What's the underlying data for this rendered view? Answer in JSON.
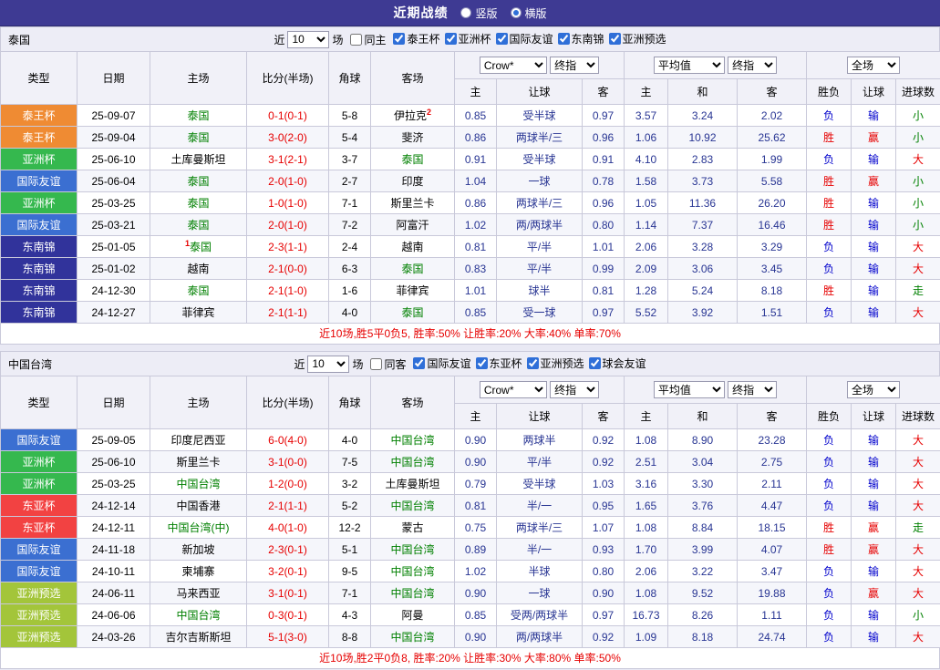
{
  "topbar": {
    "title": "近期战绩",
    "radio_vertical": "竖版",
    "radio_horizontal": "横版"
  },
  "labels": {
    "recent_pre": "近",
    "recent_post": "场"
  },
  "header": {
    "type": "类型",
    "date": "日期",
    "home": "主场",
    "score": "比分(半场)",
    "corner": "角球",
    "away": "客场",
    "sub_home": "主",
    "sub_handicap": "让球",
    "sub_away": "客",
    "avg_home": "主",
    "avg_draw": "和",
    "avg_away": "客",
    "result": "胜负",
    "result_handicap": "让球",
    "result_goals": "进球数"
  },
  "selects": {
    "company": "Crow*",
    "final": "终指",
    "average": "平均值",
    "scope": "全场"
  },
  "type_colors": {
    "泰王杯": "#ef8b33",
    "亚洲杯": "#35b84e",
    "国际友谊": "#3b6fd1",
    "东南锦": "#31339b",
    "东亚杯": "#f24242",
    "亚洲预选": "#a3c53a"
  },
  "outcome_colors": {
    "win": "#e60000",
    "lose": "#0000cc",
    "push": "#008000"
  },
  "outcome_map": {
    "胜": "win",
    "赢": "win",
    "大": "win",
    "负": "lose",
    "输": "lose",
    "小": "push",
    "走": "push"
  },
  "sections": [
    {
      "team": "泰国",
      "filter": {
        "recent": "10",
        "same_label": "同主",
        "same_checked": false,
        "comps": [
          {
            "label": "泰王杯",
            "checked": true
          },
          {
            "label": "亚洲杯",
            "checked": true
          },
          {
            "label": "国际友谊",
            "checked": true
          },
          {
            "label": "东南锦",
            "checked": true
          },
          {
            "label": "亚洲预选",
            "checked": true
          }
        ]
      },
      "rows": [
        {
          "type": "泰王杯",
          "date": "25-09-07",
          "home": "泰国",
          "home_hl": true,
          "score": "0-1(0-1)",
          "corner": "5-8",
          "away": "伊拉克",
          "away_sup": "2",
          "o1": "0.85",
          "hc": "受半球",
          "o2": "0.97",
          "a1": "3.57",
          "a2": "3.24",
          "a3": "2.02",
          "res": "负",
          "hres": "输",
          "goal": "小"
        },
        {
          "type": "泰王杯",
          "date": "25-09-04",
          "home": "泰国",
          "home_hl": true,
          "score": "3-0(2-0)",
          "corner": "5-4",
          "away": "斐济",
          "o1": "0.86",
          "hc": "两球半/三",
          "o2": "0.96",
          "a1": "1.06",
          "a2": "10.92",
          "a3": "25.62",
          "res": "胜",
          "hres": "赢",
          "goal": "小"
        },
        {
          "type": "亚洲杯",
          "date": "25-06-10",
          "home": "土库曼斯坦",
          "score": "3-1(2-1)",
          "corner": "3-7",
          "away": "泰国",
          "away_hl": true,
          "o1": "0.91",
          "hc": "受半球",
          "o2": "0.91",
          "a1": "4.10",
          "a2": "2.83",
          "a3": "1.99",
          "res": "负",
          "hres": "输",
          "goal": "大"
        },
        {
          "type": "国际友谊",
          "date": "25-06-04",
          "home": "泰国",
          "home_hl": true,
          "score": "2-0(1-0)",
          "corner": "2-7",
          "away": "印度",
          "o1": "1.04",
          "hc": "一球",
          "o2": "0.78",
          "a1": "1.58",
          "a2": "3.73",
          "a3": "5.58",
          "res": "胜",
          "hres": "赢",
          "goal": "小"
        },
        {
          "type": "亚洲杯",
          "date": "25-03-25",
          "home": "泰国",
          "home_hl": true,
          "score": "1-0(1-0)",
          "corner": "7-1",
          "away": "斯里兰卡",
          "o1": "0.86",
          "hc": "两球半/三",
          "o2": "0.96",
          "a1": "1.05",
          "a2": "11.36",
          "a3": "26.20",
          "res": "胜",
          "hres": "输",
          "goal": "小"
        },
        {
          "type": "国际友谊",
          "date": "25-03-21",
          "home": "泰国",
          "home_hl": true,
          "score": "2-0(1-0)",
          "corner": "7-2",
          "away": "阿富汗",
          "o1": "1.02",
          "hc": "两/两球半",
          "o2": "0.80",
          "a1": "1.14",
          "a2": "7.37",
          "a3": "16.46",
          "res": "胜",
          "hres": "输",
          "goal": "小"
        },
        {
          "type": "东南锦",
          "date": "25-01-05",
          "home": "泰国",
          "home_hl": true,
          "home_sup": "1",
          "score": "2-3(1-1)",
          "corner": "2-4",
          "away": "越南",
          "o1": "0.81",
          "hc": "平/半",
          "o2": "1.01",
          "a1": "2.06",
          "a2": "3.28",
          "a3": "3.29",
          "res": "负",
          "hres": "输",
          "goal": "大"
        },
        {
          "type": "东南锦",
          "date": "25-01-02",
          "home": "越南",
          "score": "2-1(0-0)",
          "corner": "6-3",
          "away": "泰国",
          "away_hl": true,
          "o1": "0.83",
          "hc": "平/半",
          "o2": "0.99",
          "a1": "2.09",
          "a2": "3.06",
          "a3": "3.45",
          "res": "负",
          "hres": "输",
          "goal": "大"
        },
        {
          "type": "东南锦",
          "date": "24-12-30",
          "home": "泰国",
          "home_hl": true,
          "score": "2-1(1-0)",
          "corner": "1-6",
          "away": "菲律宾",
          "o1": "1.01",
          "hc": "球半",
          "o2": "0.81",
          "a1": "1.28",
          "a2": "5.24",
          "a3": "8.18",
          "res": "胜",
          "hres": "输",
          "goal": "走"
        },
        {
          "type": "东南锦",
          "date": "24-12-27",
          "home": "菲律宾",
          "score": "2-1(1-1)",
          "corner": "4-0",
          "away": "泰国",
          "away_hl": true,
          "o1": "0.85",
          "hc": "受一球",
          "o2": "0.97",
          "a1": "5.52",
          "a2": "3.92",
          "a3": "1.51",
          "res": "负",
          "hres": "输",
          "goal": "大"
        }
      ],
      "summary": "近10场,胜5平0负5, 胜率:50% 让胜率:20% 大率:40% 单率:70%"
    },
    {
      "team": "中国台湾",
      "filter": {
        "recent": "10",
        "same_label": "同客",
        "same_checked": false,
        "comps": [
          {
            "label": "国际友谊",
            "checked": true
          },
          {
            "label": "东亚杯",
            "checked": true
          },
          {
            "label": "亚洲预选",
            "checked": true
          },
          {
            "label": "球会友谊",
            "checked": true
          }
        ]
      },
      "rows": [
        {
          "type": "国际友谊",
          "date": "25-09-05",
          "home": "印度尼西亚",
          "score": "6-0(4-0)",
          "corner": "4-0",
          "away": "中国台湾",
          "away_hl": true,
          "o1": "0.90",
          "hc": "两球半",
          "o2": "0.92",
          "a1": "1.08",
          "a2": "8.90",
          "a3": "23.28",
          "res": "负",
          "hres": "输",
          "goal": "大"
        },
        {
          "type": "亚洲杯",
          "date": "25-06-10",
          "home": "斯里兰卡",
          "score": "3-1(0-0)",
          "corner": "7-5",
          "away": "中国台湾",
          "away_hl": true,
          "o1": "0.90",
          "hc": "平/半",
          "o2": "0.92",
          "a1": "2.51",
          "a2": "3.04",
          "a3": "2.75",
          "res": "负",
          "hres": "输",
          "goal": "大"
        },
        {
          "type": "亚洲杯",
          "date": "25-03-25",
          "home": "中国台湾",
          "home_hl": true,
          "score": "1-2(0-0)",
          "corner": "3-2",
          "away": "土库曼斯坦",
          "o1": "0.79",
          "hc": "受半球",
          "o2": "1.03",
          "a1": "3.16",
          "a2": "3.30",
          "a3": "2.11",
          "res": "负",
          "hres": "输",
          "goal": "大"
        },
        {
          "type": "东亚杯",
          "date": "24-12-14",
          "home": "中国香港",
          "score": "2-1(1-1)",
          "corner": "5-2",
          "away": "中国台湾",
          "away_hl": true,
          "o1": "0.81",
          "hc": "半/一",
          "o2": "0.95",
          "a1": "1.65",
          "a2": "3.76",
          "a3": "4.47",
          "res": "负",
          "hres": "输",
          "goal": "大"
        },
        {
          "type": "东亚杯",
          "date": "24-12-11",
          "home": "中国台湾(中)",
          "home_hl": true,
          "score": "4-0(1-0)",
          "corner": "12-2",
          "away": "蒙古",
          "o1": "0.75",
          "hc": "两球半/三",
          "o2": "1.07",
          "a1": "1.08",
          "a2": "8.84",
          "a3": "18.15",
          "res": "胜",
          "hres": "赢",
          "goal": "走"
        },
        {
          "type": "国际友谊",
          "date": "24-11-18",
          "home": "新加坡",
          "score": "2-3(0-1)",
          "corner": "5-1",
          "away": "中国台湾",
          "away_hl": true,
          "o1": "0.89",
          "hc": "半/一",
          "o2": "0.93",
          "a1": "1.70",
          "a2": "3.99",
          "a3": "4.07",
          "res": "胜",
          "hres": "赢",
          "goal": "大"
        },
        {
          "type": "国际友谊",
          "date": "24-10-11",
          "home": "柬埔寨",
          "score": "3-2(0-1)",
          "corner": "9-5",
          "away": "中国台湾",
          "away_hl": true,
          "o1": "1.02",
          "hc": "半球",
          "o2": "0.80",
          "a1": "2.06",
          "a2": "3.22",
          "a3": "3.47",
          "res": "负",
          "hres": "输",
          "goal": "大"
        },
        {
          "type": "亚洲预选",
          "date": "24-06-11",
          "home": "马来西亚",
          "score": "3-1(0-1)",
          "corner": "7-1",
          "away": "中国台湾",
          "away_hl": true,
          "o1": "0.90",
          "hc": "一球",
          "o2": "0.90",
          "a1": "1.08",
          "a2": "9.52",
          "a3": "19.88",
          "res": "负",
          "hres": "赢",
          "goal": "大"
        },
        {
          "type": "亚洲预选",
          "date": "24-06-06",
          "home": "中国台湾",
          "home_hl": true,
          "score": "0-3(0-1)",
          "corner": "4-3",
          "away": "阿曼",
          "o1": "0.85",
          "hc": "受两/两球半",
          "o2": "0.97",
          "a1": "16.73",
          "a2": "8.26",
          "a3": "1.11",
          "res": "负",
          "hres": "输",
          "goal": "小"
        },
        {
          "type": "亚洲预选",
          "date": "24-03-26",
          "home": "吉尔吉斯斯坦",
          "score": "5-1(3-0)",
          "corner": "8-8",
          "away": "中国台湾",
          "away_hl": true,
          "o1": "0.90",
          "hc": "两/两球半",
          "o2": "0.92",
          "a1": "1.09",
          "a2": "8.18",
          "a3": "24.74",
          "res": "负",
          "hres": "输",
          "goal": "大"
        }
      ],
      "summary": "近10场,胜2平0负8, 胜率:20% 让胜率:30% 大率:80% 单率:50%"
    }
  ]
}
